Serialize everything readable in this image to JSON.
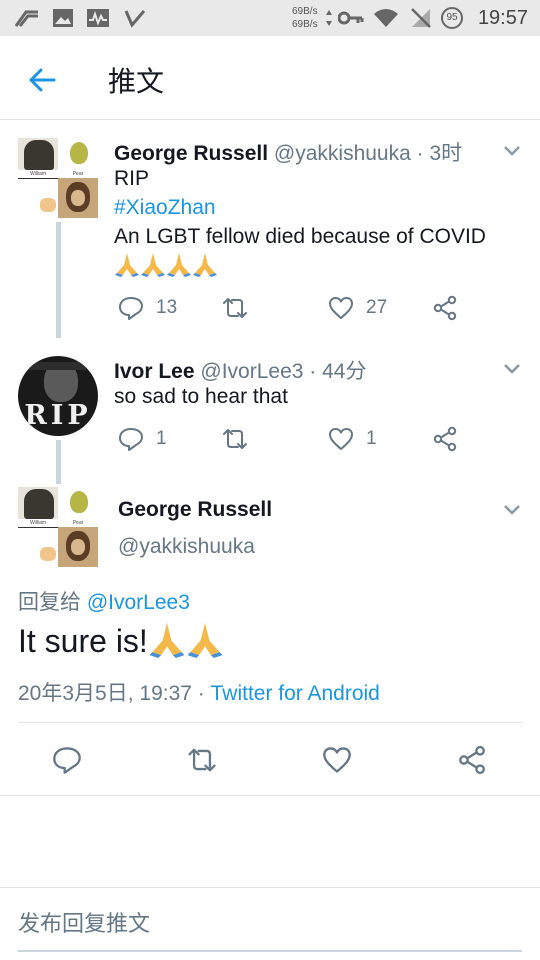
{
  "status_bar": {
    "net_up": "69B/s",
    "net_down": "69B/s",
    "battery": "95",
    "time": "19:57"
  },
  "header": {
    "title": "推文"
  },
  "tweets": [
    {
      "name": "George Russell",
      "handle": "@yakkishuuka",
      "time": "· 3时",
      "lines": [
        "RIP",
        "#XiaoZhan",
        "An LGBT fellow died because of COVID"
      ],
      "reply_count": "13",
      "retweet_count": "",
      "like_count": "27",
      "avatar_labels": [
        "William",
        "Pear"
      ]
    },
    {
      "name": "Ivor Lee",
      "handle": "@IvorLee3",
      "time": "· 44分",
      "lines": [
        "so sad to hear that"
      ],
      "reply_count": "1",
      "retweet_count": "",
      "like_count": "1",
      "avatar_text": "RIP"
    }
  ],
  "focused": {
    "name": "George Russell",
    "handle": "@yakkishuuka",
    "reply_prefix": "回复给",
    "reply_mention": "@IvorLee3",
    "text": "It sure is!",
    "date": "20年3月5日, 19:37 · ",
    "source": "Twitter for Android",
    "avatar_labels": [
      "William",
      "Pear"
    ]
  },
  "compose": {
    "placeholder": "发布回复推文"
  },
  "colors": {
    "accent": "#1b95e0",
    "muted": "#657786",
    "thread": "#c9d6df"
  }
}
